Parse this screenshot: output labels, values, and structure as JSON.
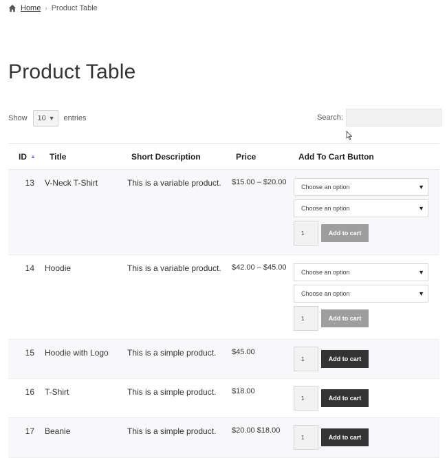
{
  "breadcrumb": {
    "home": "Home",
    "separator": "›",
    "current": "Product Table"
  },
  "page_title": "Product Table",
  "length_control": {
    "show": "Show",
    "value": "10",
    "entries": "entries"
  },
  "search": {
    "label": "Search:",
    "value": ""
  },
  "table": {
    "headers": {
      "id": "ID",
      "title": "Title",
      "desc": "Short Description",
      "price": "Price",
      "cart": "Add To Cart Button"
    },
    "rows": [
      {
        "id": "13",
        "title": "V-Neck T-Shirt",
        "desc": "This is a variable product.",
        "price": "$15.00 – $20.00",
        "options": [
          "Choose an option",
          "Choose an option"
        ],
        "qty": "1",
        "button": "Add to cart",
        "button_state": "disabled"
      },
      {
        "id": "14",
        "title": "Hoodie",
        "desc": "This is a variable product.",
        "price": "$42.00 – $45.00",
        "options": [
          "Choose an option",
          "Choose an option"
        ],
        "qty": "1",
        "button": "Add to cart",
        "button_state": "disabled"
      },
      {
        "id": "15",
        "title": "Hoodie with Logo",
        "desc": "This is a simple product.",
        "price": "$45.00",
        "options": [],
        "qty": "1",
        "button": "Add to cart",
        "button_state": "active"
      },
      {
        "id": "16",
        "title": "T-Shirt",
        "desc": "This is a simple product.",
        "price": "$18.00",
        "options": [],
        "qty": "1",
        "button": "Add to cart",
        "button_state": "active"
      },
      {
        "id": "17",
        "title": "Beanie",
        "desc": "This is a simple product.",
        "price": "$20.00 $18.00",
        "options": [],
        "qty": "1",
        "button": "Add to cart",
        "button_state": "active"
      }
    ]
  },
  "colors": {
    "accent_sort": "#7b7ad6",
    "button_dark": "#333333",
    "button_disabled": "#9e9e9e",
    "row_stripe": "#f8f8fa"
  },
  "icons": {
    "home": "home-icon",
    "select_chevron": "chevron-down-icon",
    "sort": "sort-ascending-icon",
    "cursor": "mouse-cursor-icon"
  }
}
